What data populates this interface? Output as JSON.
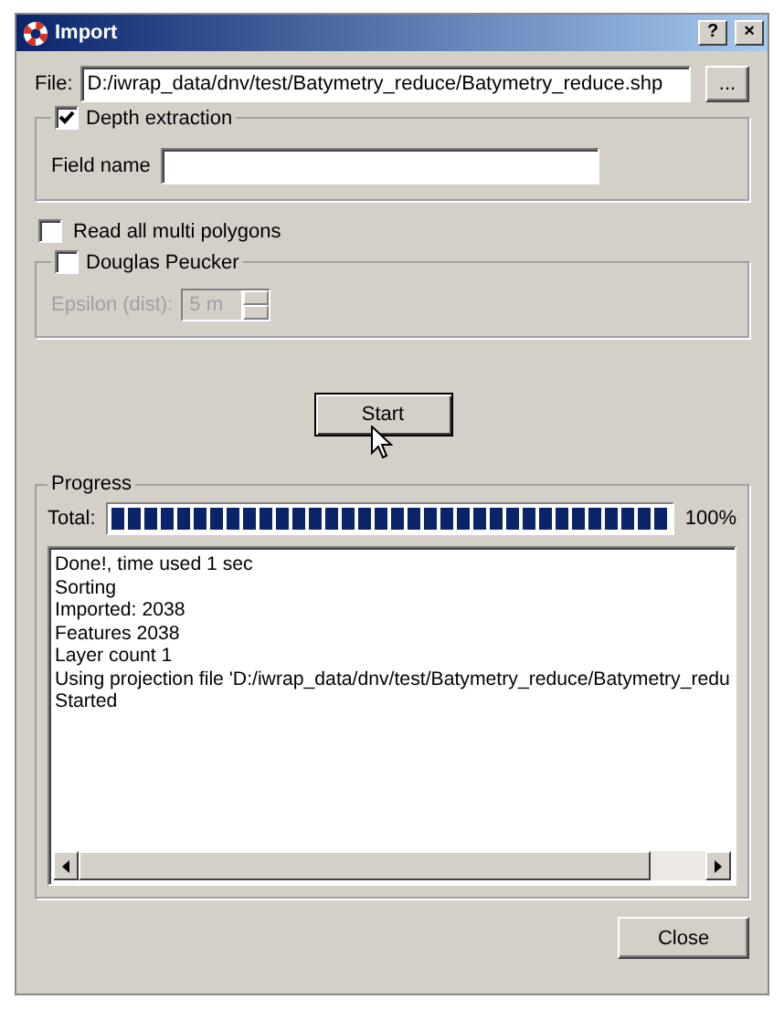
{
  "window": {
    "title": "Import",
    "help_button": "?",
    "close_button": "×"
  },
  "file": {
    "label": "File:",
    "value": "D:/iwrap_data/dnv/test/Batymetry_reduce/Batymetry_reduce.shp",
    "browse_button": "..."
  },
  "depth_extraction": {
    "label": "Depth extraction",
    "checked": true,
    "field_label": "Field name"
  },
  "read_all": {
    "label": "Read all multi polygons",
    "checked": false
  },
  "douglas_peucker": {
    "label": "Douglas Peucker",
    "checked": false,
    "epsilon_label": "Epsilon (dist):",
    "epsilon_value": "5 m",
    "disabled": true
  },
  "start_button": "Start",
  "progress": {
    "title": "Progress",
    "total_label": "Total:",
    "level": 1.0,
    "reading": "100%",
    "log": [
      "Done!, time used 1 sec",
      "Sorting",
      "Imported: 2038",
      "Features 2038",
      "Layer count 1",
      "Using projection file 'D:/iwrap_data/dnv/test/Batymetry_reduce/Batymetry_redu",
      "Started"
    ]
  },
  "close_button": "Close"
}
